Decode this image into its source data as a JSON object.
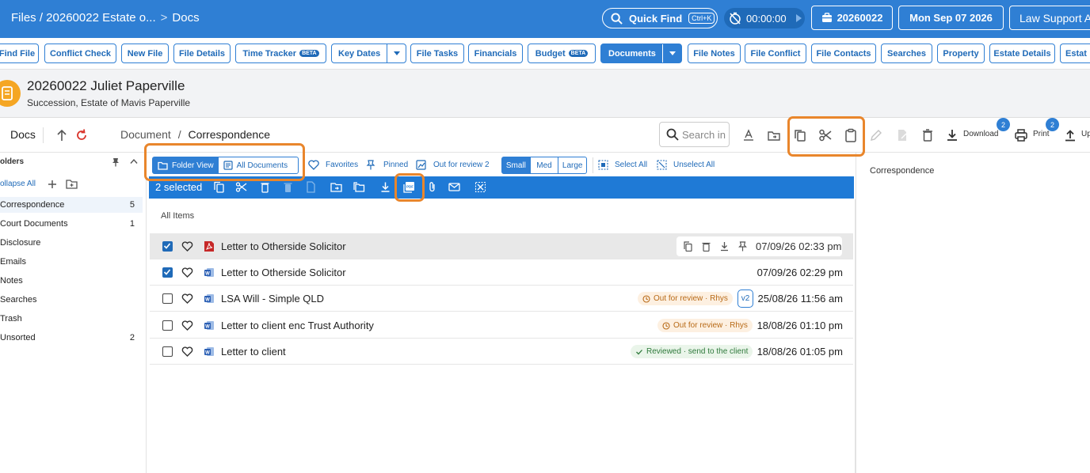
{
  "topbar": {
    "breadcrumb_file": "Files / 20260022 Estate o...",
    "breadcrumb_sep": ">",
    "breadcrumb_page": "Docs",
    "quick_find_label": "Quick Find",
    "quick_find_kbd": "Ctrl+K",
    "timer": "00:00:00",
    "matter_button": "20260022",
    "date_button": "Mon Sep 07 2026",
    "brand_button": "Law Support A"
  },
  "tabs": {
    "find_file": "Find File",
    "conflict_check": "Conflict Check",
    "new_file": "New File",
    "file_details": "File Details",
    "time_tracker": "Time Tracker",
    "beta": "BETA",
    "key_dates": "Key Dates",
    "file_tasks": "File Tasks",
    "financials": "Financials",
    "budget": "Budget",
    "documents": "Documents",
    "file_notes": "File Notes",
    "file_conflict": "File Conflict",
    "file_contacts": "File Contacts",
    "searches": "Searches",
    "property": "Property",
    "estate_details": "Estate Details",
    "estat": "Estat"
  },
  "header": {
    "title": "20260022 Juliet Paperville",
    "subtitle": "Succession, Estate of Mavis Paperville"
  },
  "docsbar": {
    "label": "Docs",
    "path_root": "Document",
    "path_sep": "/",
    "path_current": "Correspondence",
    "search_placeholder": "Search in",
    "download_label": "Download",
    "download_badge": "2",
    "print_label": "Print",
    "print_badge": "2",
    "upload_label": "Up"
  },
  "sidebar": {
    "heading": "olders",
    "collapse_all": "ollapse All",
    "items": [
      {
        "label": "Correspondence",
        "count": "5"
      },
      {
        "label": "Court Documents",
        "count": "1"
      },
      {
        "label": "Disclosure",
        "count": ""
      },
      {
        "label": "Emails",
        "count": ""
      },
      {
        "label": "Notes",
        "count": ""
      },
      {
        "label": "Searches",
        "count": ""
      },
      {
        "label": "Trash",
        "count": ""
      },
      {
        "label": "Unsorted",
        "count": "2"
      }
    ]
  },
  "options": {
    "folder_view": "Folder View",
    "all_documents": "All Documents",
    "favorites": "Favorites",
    "pinned": "Pinned",
    "out_for_review": "Out for review 2",
    "small": "Small",
    "med": "Med",
    "large": "Large",
    "select_all": "Select All",
    "unselect_all": "Unselect All"
  },
  "selection": {
    "count_text": "2 selected"
  },
  "list": {
    "section_label": "All Items",
    "rows": [
      {
        "name": "Letter to Otherside Solicitor",
        "date": "07/09/26 02:33 pm",
        "type": "pdf",
        "checked": true,
        "status": "",
        "version": ""
      },
      {
        "name": "Letter to Otherside Solicitor",
        "date": "07/09/26 02:29 pm",
        "type": "word",
        "checked": true,
        "status": "",
        "version": ""
      },
      {
        "name": "LSA Will - Simple QLD",
        "date": "25/08/26 11:56 am",
        "type": "word",
        "checked": false,
        "status": "Out for review · Rhys",
        "version": "v2"
      },
      {
        "name": "Letter to client enc Trust Authority",
        "date": "18/08/26 01:10 pm",
        "type": "word",
        "checked": false,
        "status": "Out for review · Rhys",
        "version": ""
      },
      {
        "name": "Letter to client",
        "date": "18/08/26 01:05 pm",
        "type": "word",
        "checked": false,
        "status": "Reviewed · send to the client",
        "version": ""
      }
    ]
  },
  "preview": {
    "title": "Correspondence"
  },
  "colors": {
    "primary": "#2f7fd4",
    "highlight": "#e9862c",
    "pdf": "#c62828",
    "word": "#2b5fb4"
  }
}
